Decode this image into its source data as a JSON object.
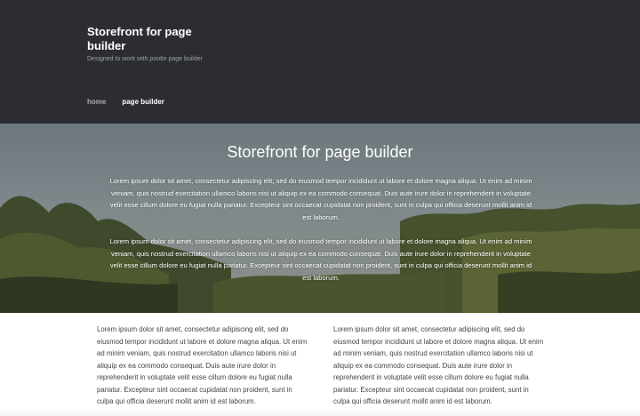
{
  "header": {
    "site_title": "Storefront for page builder",
    "site_description": "Designed to work with pootle page builder",
    "nav": {
      "home": "home",
      "page_builder": "page builder"
    }
  },
  "hero": {
    "title": "Storefront for page builder",
    "paragraph_1": "Lorem ipsum dolor sit amet, consectetur adipiscing elit, sed do eiusmod tempor incididunt ut labore et dolore magna aliqua. Ut enim ad minim veniam, quis nostrud exercitation ullamco laboris nisi ut aliquip ex ea commodo consequat. Duis aute irure dolor in reprehenderit in voluptate velit esse cillum dolore eu fugiat nulla pariatur. Excepteur sint occaecat cupidatat non proident, sunt in culpa qui officia deserunt mollit anim id est laborum.",
    "paragraph_2": "Lorem ipsum dolor sit amet, consectetur adipiscing elit, sed do eiusmod tempor incididunt ut labore et dolore magna aliqua. Ut enim ad minim veniam, quis nostrud exercitation ullamco laboris nisi ut aliquip ex ea commodo consequat. Duis aute irure dolor in reprehenderit in voluptate velit esse cillum dolore eu fugiat nulla pariatur. Excepteur sint occaecat cupidatat non proident, sunt in culpa qui officia deserunt mollit anim id est laborum."
  },
  "content": {
    "left_column": "Lorem ipsum dolor sit amet, consectetur adipiscing elit, sed do eiusmod tempor incididunt ut labore et dolore magna aliqua. Ut enim ad minim veniam, quis nostrud exercitation ullamco laboris nisi ut aliquip ex ea commodo consequat. Duis aute irure dolor in reprehenderit in voluptate velit esse cillum dolore eu fugiat nulla pariatur. Excepteur sint occaecat cupidatat non proident, sunt in culpa qui officia deserunt mollit anim id est laborum.",
    "right_column": "Lorem ipsum dolor sit amet, consectetur adipiscing elit, sed do eiusmod tempor incididunt ut labore et dolore magna aliqua. Ut enim ad minim veniam, quis nostrud exercitation ullamco laboris nisi ut aliquip ex ea commodo consequat. Duis aute irure dolor in reprehenderit in voluptate velit esse cillum dolore eu fugiat nulla pariatur. Excepteur sint occaecat cupidatat non proident, sunt in culpa qui officia deserunt mollit anim id est laborum."
  },
  "colors": {
    "header_bg": "#2c2d33",
    "nav_active": "#ffffff",
    "nav_inactive": "#a9acb3",
    "body_text": "#43454b"
  }
}
